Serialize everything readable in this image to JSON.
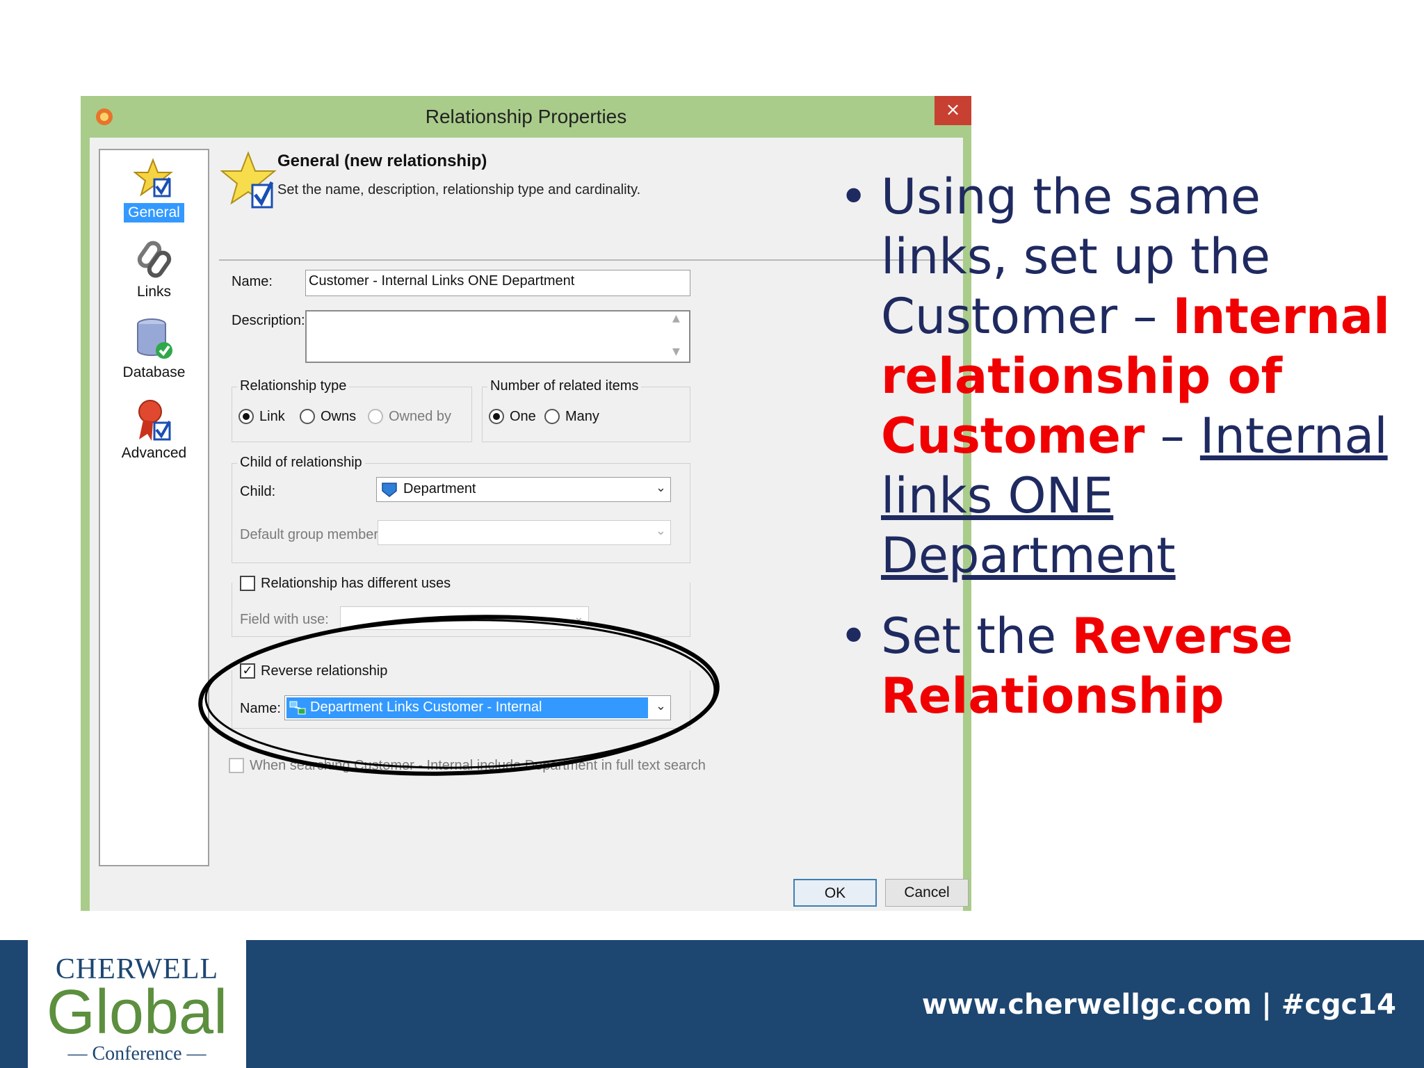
{
  "dialog": {
    "title": "Relationship Properties",
    "close_symbol": "×"
  },
  "nav": {
    "items": [
      {
        "label": "General",
        "icon": "star-check-icon",
        "selected": true
      },
      {
        "label": "Links",
        "icon": "chain-link-icon",
        "selected": false
      },
      {
        "label": "Database",
        "icon": "database-icon",
        "selected": false
      },
      {
        "label": "Advanced",
        "icon": "ribbon-award-icon",
        "selected": false
      }
    ]
  },
  "header": {
    "title": "General  (new relationship)",
    "subtitle": "Set the name, description, relationship type and cardinality."
  },
  "form": {
    "name_label": "Name:",
    "name_value": "Customer - Internal Links ONE Department",
    "description_label": "Description:",
    "description_value": "",
    "relationship_type": {
      "title": "Relationship type",
      "options": [
        "Link",
        "Owns",
        "Owned by"
      ],
      "selected": "Link"
    },
    "related_items": {
      "title": "Number of related items",
      "options": [
        "One",
        "Many"
      ],
      "selected": "One"
    },
    "child": {
      "group_title": "Child of relationship",
      "child_label": "Child:",
      "child_value": "Department",
      "default_group_label": "Default group member:",
      "default_group_value": ""
    },
    "uses": {
      "checkbox_label": "Relationship has different uses",
      "checked": false,
      "field_label": "Field with use:",
      "field_value": ""
    },
    "reverse": {
      "checkbox_label": "Reverse relationship",
      "checked": true,
      "check_mark": "✓",
      "name_label": "Name:",
      "name_value": "Department Links Customer - Internal"
    },
    "search_option": "When searching Customer - Internal include Department in full text search"
  },
  "buttons": {
    "ok": "OK",
    "cancel": "Cancel"
  },
  "bullets": {
    "b1_part1": "Using the same links, set up the Customer – ",
    "b1_red1": "Internal relationship of Customer",
    "b1_part2": " – ",
    "b1_link": "Internal links ONE Department",
    "b2_part1": "Set the ",
    "b2_red": "Reverse Relationship",
    "dot": "•"
  },
  "footer": {
    "logo_cherwell": "CHERWELL",
    "logo_global": "Global",
    "logo_conference": "— Conference —",
    "url": "www.cherwellgc.com | #cgc14"
  },
  "colors": {
    "titlebar": "#a9cc8a",
    "accent_blue": "#3399ff",
    "bullet_text": "#1f2a60",
    "highlight_red": "#f00000",
    "footer_bg": "#1d4670",
    "close_button": "#c84031"
  }
}
